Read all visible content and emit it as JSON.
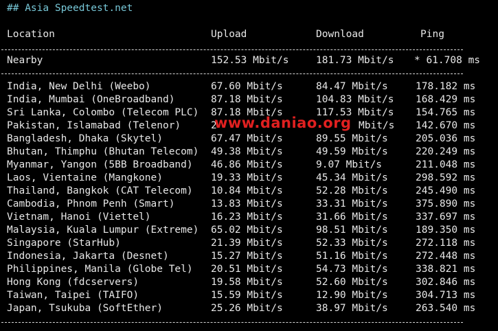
{
  "title": "## Asia Speedtest.net",
  "columns": {
    "location": "Location",
    "upload": "Upload",
    "download": "Download",
    "ping": "Ping"
  },
  "nearby": {
    "location": "Nearby",
    "upload": "152.53 Mbit/s",
    "download": "181.73 Mbit/s",
    "ping": "* 61.708 ms"
  },
  "rows": [
    {
      "location": "India, New Delhi (Weebo)",
      "upload": "67.60 Mbit/s",
      "download": "84.47 Mbit/s",
      "ping": "178.182 ms"
    },
    {
      "location": "India, Mumbai (OneBroadband)",
      "upload": "87.18 Mbit/s",
      "download": "104.83 Mbit/s",
      "ping": "168.429 ms"
    },
    {
      "location": "Sri Lanka, Colombo (Telecom PLC)",
      "upload": "87.18 Mbit/s",
      "download": "117.53 Mbit/s",
      "ping": "154.765 ms"
    },
    {
      "location": "Pakistan, Islamabad (Telenor)",
      "upload": "2",
      "download": "Mbit/s",
      "ping": "142.670 ms"
    },
    {
      "location": "Bangladesh, Dhaka (Skytel)",
      "upload": "67.47 Mbit/s",
      "download": "89.55 Mbit/s",
      "ping": "205.036 ms"
    },
    {
      "location": "Bhutan, Thimphu (Bhutan Telecom)",
      "upload": "49.38 Mbit/s",
      "download": "49.59 Mbit/s",
      "ping": "220.249 ms"
    },
    {
      "location": "Myanmar, Yangon (5BB Broadband)",
      "upload": "46.86 Mbit/s",
      "download": "9.07 Mbit/s",
      "ping": "211.048 ms"
    },
    {
      "location": "Laos, Vientaine (Mangkone)",
      "upload": "19.33 Mbit/s",
      "download": "45.34 Mbit/s",
      "ping": "298.592 ms"
    },
    {
      "location": "Thailand, Bangkok (CAT Telecom)",
      "upload": "10.84 Mbit/s",
      "download": "52.28 Mbit/s",
      "ping": "245.490 ms"
    },
    {
      "location": "Cambodia, Phnom Penh (Smart)",
      "upload": "13.83 Mbit/s",
      "download": "33.31 Mbit/s",
      "ping": "375.890 ms"
    },
    {
      "location": "Vietnam, Hanoi (Viettel)",
      "upload": "16.23 Mbit/s",
      "download": "31.66 Mbit/s",
      "ping": "337.697 ms"
    },
    {
      "location": "Malaysia, Kuala Lumpur (Extreme)",
      "upload": "65.02 Mbit/s",
      "download": "98.51 Mbit/s",
      "ping": "189.350 ms"
    },
    {
      "location": "Singapore (StarHub)",
      "upload": "21.39 Mbit/s",
      "download": "52.33 Mbit/s",
      "ping": "272.118 ms"
    },
    {
      "location": "Indonesia, Jakarta (Desnet)",
      "upload": "15.27 Mbit/s",
      "download": "51.16 Mbit/s",
      "ping": "272.448 ms"
    },
    {
      "location": "Philippines, Manila (Globe Tel)",
      "upload": "20.51 Mbit/s",
      "download": "54.73 Mbit/s",
      "ping": "338.821 ms"
    },
    {
      "location": "Hong Kong (fdcservers)",
      "upload": "19.58 Mbit/s",
      "download": "52.60 Mbit/s",
      "ping": "302.846 ms"
    },
    {
      "location": "Taiwan, Taipei (TAIFO)",
      "upload": "15.59 Mbit/s",
      "download": "12.90 Mbit/s",
      "ping": "304.713 ms"
    },
    {
      "location": "Japan, Tsukuba (SoftEther)",
      "upload": "25.26 Mbit/s",
      "download": "38.97 Mbit/s",
      "ping": "263.540 ms"
    }
  ],
  "watermark": "www.daniao.org",
  "colors": {
    "background": "#000000",
    "text": "#e8e8e8",
    "title": "#78c8d8",
    "watermark": "#e02020"
  }
}
